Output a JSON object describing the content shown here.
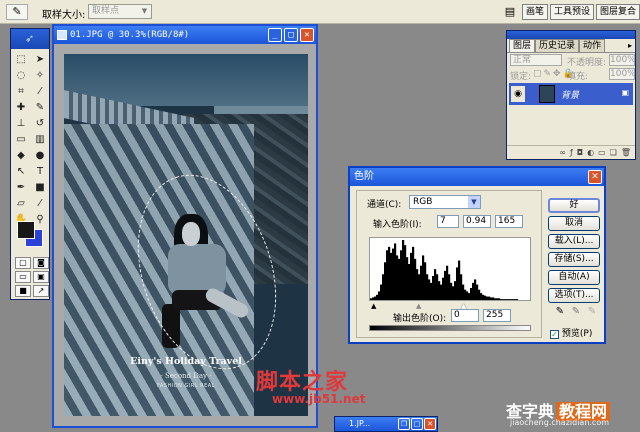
{
  "options_bar": {
    "sample_size_label": "取样大小:",
    "sample_size_value": "取样点",
    "well_tabs": [
      "画笔",
      "工具预设",
      "图层复合"
    ]
  },
  "document": {
    "title": "01.JPG @ 30.3%(RGB/8#)",
    "photo_caption_title": "Einy's Holiday Travel",
    "photo_caption_sub": "- Second Day -",
    "photo_caption_small": "FASHION GIRL REAL"
  },
  "layers_palette": {
    "tabs": [
      "图层",
      "历史记录",
      "动作"
    ],
    "blend_mode": "正常",
    "opacity_label": "不透明度:",
    "opacity_value": "100%",
    "lock_label": "锁定:",
    "fill_label": "填充:",
    "fill_value": "100%",
    "layer_name": "背景"
  },
  "levels_dialog": {
    "title": "色阶",
    "channel_label": "通道(C):",
    "channel_value": "RGB",
    "input_label": "输入色阶(I):",
    "input_black": "7",
    "input_gamma": "0.94",
    "input_white": "165",
    "output_label": "输出色阶(O):",
    "output_black": "0",
    "output_white": "255",
    "buttons": [
      "好",
      "取消",
      "载入(L)...",
      "存储(S)...",
      "自动(A)",
      "选项(T)..."
    ],
    "preview_label": "预览(P)",
    "preview_checked": true
  },
  "minimized_window": {
    "title": "1.JP..."
  },
  "watermarks": {
    "site_cn": "脚本之家",
    "site_url": "www.jb51.net",
    "brand": "查字典",
    "brand_box": "教程网",
    "brand_url": "jiaocheng.chazidian.com"
  },
  "colors": {
    "foreground": "#181818",
    "background": "#2b41d8",
    "title_blue": "#1b55d9",
    "watermark_red": "#e0393b"
  },
  "histogram": {
    "bins": [
      2,
      3,
      4,
      6,
      10,
      18,
      30,
      44,
      58,
      62,
      55,
      60,
      66,
      52,
      48,
      58,
      70,
      64,
      50,
      42,
      55,
      62,
      48,
      36,
      30,
      40,
      52,
      44,
      30,
      24,
      20,
      28,
      36,
      30,
      22,
      18,
      26,
      34,
      40,
      30,
      20,
      16,
      22,
      38,
      46,
      30,
      18,
      12,
      10,
      8,
      14,
      20,
      24,
      18,
      12,
      8,
      6,
      5,
      4,
      4,
      3,
      3,
      2,
      2,
      2,
      1,
      1,
      1,
      1,
      1,
      1,
      1,
      1,
      1,
      0,
      0,
      0,
      0,
      0,
      0
    ]
  }
}
